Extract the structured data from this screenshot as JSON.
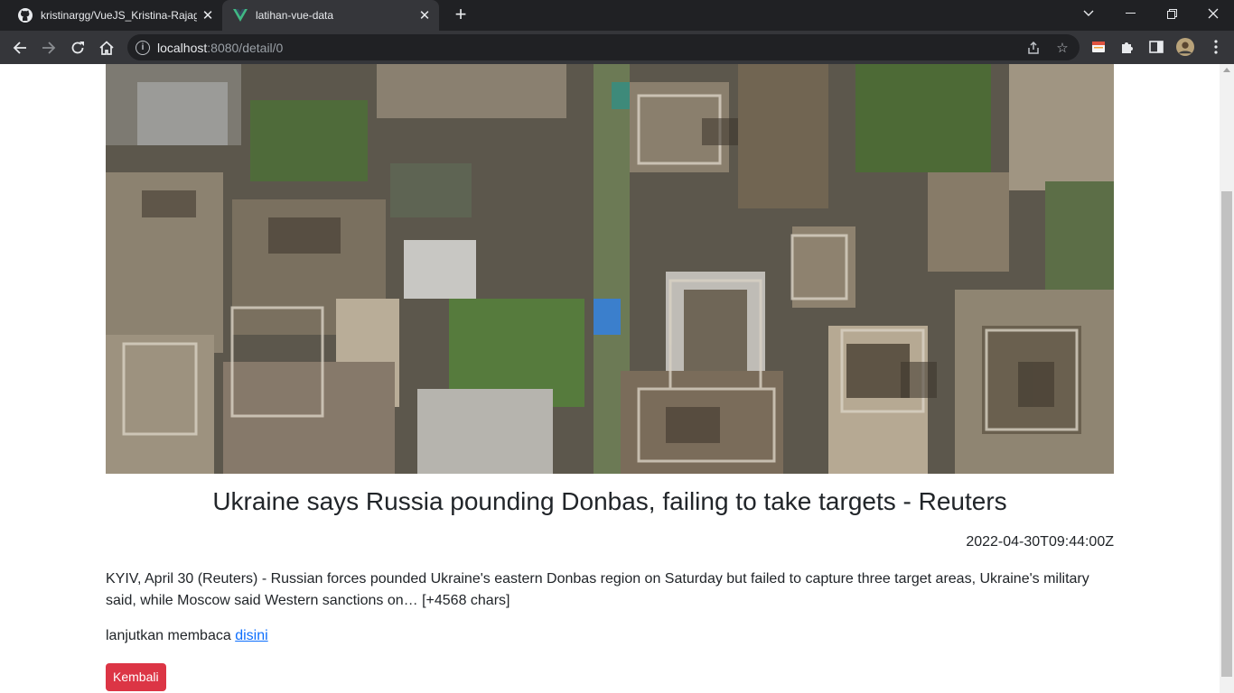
{
  "browser": {
    "tabs": [
      {
        "title": "kristinargg/VueJS_Kristina-Rajagukguk",
        "active": false,
        "icon": "github-icon"
      },
      {
        "title": "latihan-vue-data",
        "active": true,
        "icon": "vue-icon"
      }
    ],
    "url": {
      "host": "localhost",
      "path": ":8080/detail/0"
    }
  },
  "article": {
    "image_alt": "Aerial view of destroyed houses",
    "title": "Ukraine says Russia pounding Donbas, failing to take targets - Reuters",
    "published_at": "2022-04-30T09:44:00Z",
    "content": "KYIV, April 30 (Reuters) - Russian forces pounded Ukraine's eastern Donbas region on Saturday but failed to capture three target areas, Ukraine's military said, while Moscow said Western sanctions on… [+4568 chars]",
    "read_more_prefix": "lanjutkan membaca",
    "read_more_link": "disini",
    "back_button": "Kembali"
  },
  "colors": {
    "danger": "#dc3545",
    "link": "#0d6efd",
    "chrome_dark": "#202124",
    "chrome_toolbar": "#35363a"
  }
}
